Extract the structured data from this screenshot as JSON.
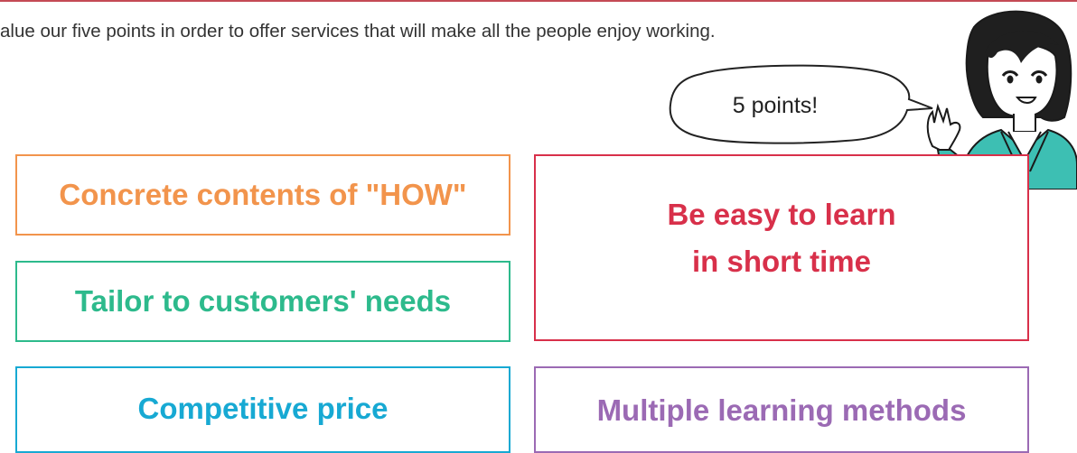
{
  "intro": {
    "text": "alue our five points in order to offer services that will make all the people enjoy working."
  },
  "bubble": {
    "text": "5 points!"
  },
  "points": {
    "how": "Concrete contents of \"HOW\"",
    "needs": "Tailor to customers' needs",
    "price": "Competitive price",
    "easy_line1": "Be easy to learn",
    "easy_line2": "in short time",
    "methods": "Multiple learning methods"
  },
  "colors": {
    "accent_rule": "#c44a55",
    "how": "#f2944c",
    "needs": "#2dba8c",
    "price": "#17a9d3",
    "easy": "#d8304a",
    "methods": "#9b6ab4",
    "jacket": "#3dbfb3"
  }
}
